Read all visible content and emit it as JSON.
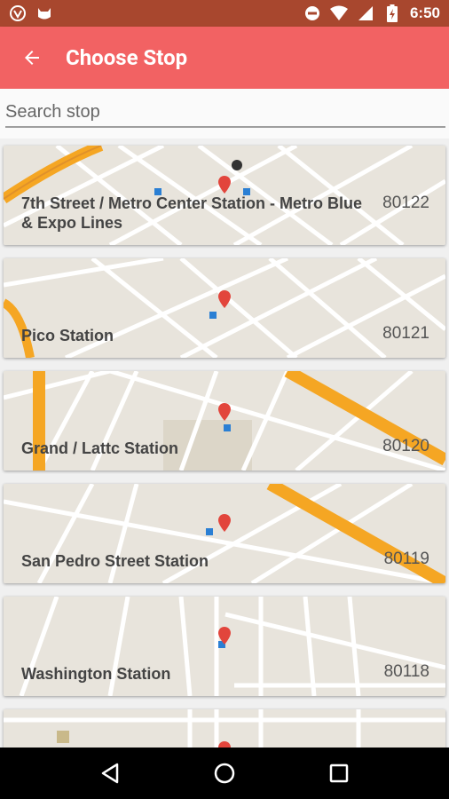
{
  "status_bar": {
    "time": "6:50",
    "icons": [
      "shield-app-icon",
      "cat-app-icon",
      "do-not-disturb-icon",
      "wifi-icon",
      "signal-icon",
      "battery-charging-icon"
    ]
  },
  "app_bar": {
    "title": "Choose Stop",
    "back_icon": "arrow-back-icon"
  },
  "search": {
    "placeholder": "Search stop",
    "value": ""
  },
  "stops": [
    {
      "name": "7th Street / Metro Center Station - Metro Blue & Expo Lines",
      "id": "80122"
    },
    {
      "name": "Pico Station",
      "id": "80121"
    },
    {
      "name": "Grand / Lattc Station",
      "id": "80120"
    },
    {
      "name": "San Pedro Street Station",
      "id": "80119"
    },
    {
      "name": "Washington Station",
      "id": "80118"
    }
  ],
  "nav_bar": {
    "icons": [
      "back-triangle-icon",
      "home-circle-icon",
      "recents-square-icon"
    ]
  },
  "colors": {
    "app_bar": "#f26263",
    "status_bar": "#a8472e",
    "map_bg": "#e8e4dc",
    "highway": "#f5a623",
    "pin": "#e2453c"
  }
}
